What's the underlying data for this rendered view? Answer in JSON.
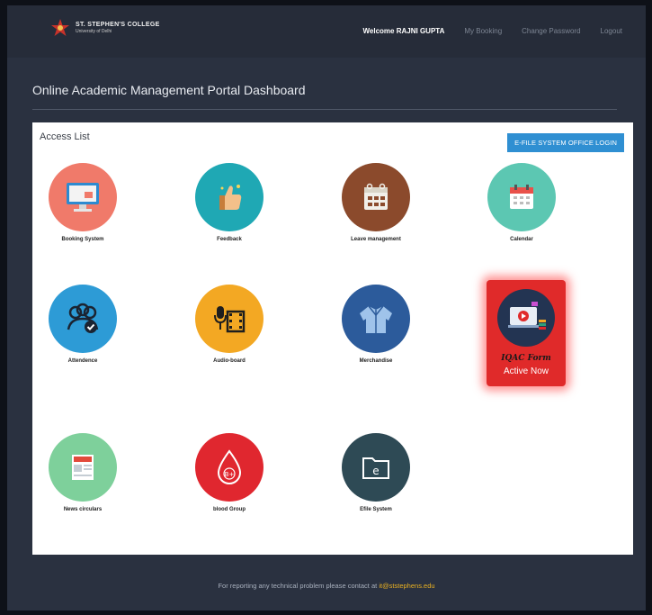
{
  "header": {
    "college_name": "ST. STEPHEN'S COLLEGE",
    "university": "University of Delhi",
    "welcome": "Welcome RAJNI GUPTA",
    "nav": [
      "My Booking",
      "Change Password",
      "Logout"
    ]
  },
  "page_title": "Online Academic Management Portal Dashboard",
  "panel": {
    "heading": "Access List",
    "efile_button": "E-FILE SYSTEM OFFICE LOGIN",
    "tiles": [
      {
        "label": "Booking System",
        "icon": "monitor-icon",
        "color": "#f07a6a"
      },
      {
        "label": "Feedback",
        "icon": "thumbs-up-icon",
        "color": "#1fa8b4"
      },
      {
        "label": "Leave management",
        "icon": "calendar-leave-icon",
        "color": "#8b4a2c"
      },
      {
        "label": "Calendar",
        "icon": "calendar-icon",
        "color": "#5cc7b2"
      },
      {
        "label": "Attendence",
        "icon": "users-check-icon",
        "color": "#2d9bd6"
      },
      {
        "label": "Audio-board",
        "icon": "mic-film-icon",
        "color": "#f3a823"
      },
      {
        "label": "Merchandise",
        "icon": "jacket-icon",
        "color": "#2c5b9b"
      },
      {
        "label": "News circulars",
        "icon": "newspaper-icon",
        "color": "#7ed09b"
      },
      {
        "label": "blood Group",
        "icon": "blood-drop-icon",
        "color": "#e0272f"
      },
      {
        "label": "Efile System",
        "icon": "folder-e-icon",
        "color": "#2e4a55"
      }
    ],
    "iqac": {
      "title": "IQAC Form",
      "subtitle": "Active Now",
      "icon": "presentation-icon",
      "color": "#e02a2a"
    }
  },
  "footer": {
    "text": "For reporting any technical problem please contact at",
    "email": "it@ststephens.edu"
  },
  "colors": {
    "accent": "#2f8fd2",
    "background": "#2a3140",
    "email": "#e8b022"
  }
}
